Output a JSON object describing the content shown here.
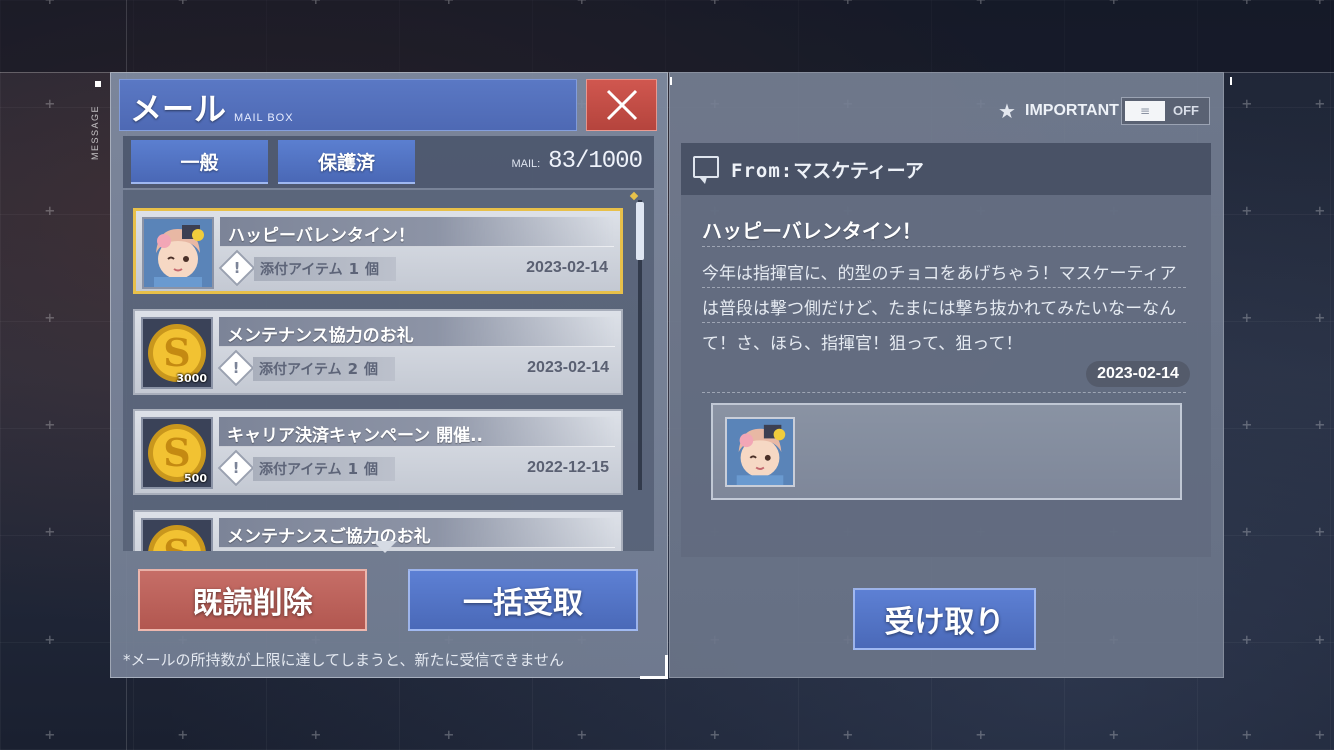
{
  "side_label": "MESSAGE",
  "header": {
    "title": "メール",
    "subtitle": "MAIL BOX"
  },
  "tabs": [
    {
      "label": "一般"
    },
    {
      "label": "保護済"
    }
  ],
  "mail_counter": {
    "label": "MAIL:",
    "value": "83/1000"
  },
  "mails": [
    {
      "title": "ハッピーバレンタイン！",
      "attach_label": "添付アイテム",
      "attach_count": "1",
      "attach_unit": "個",
      "date": "2023-02-14",
      "icon": "character-portrait-icon",
      "selected": true
    },
    {
      "title": "メンテナンス協力のお礼",
      "attach_label": "添付アイテム",
      "attach_count": "2",
      "attach_unit": "個",
      "date": "2023-02-14",
      "icon": "gold-coin-icon",
      "quantity": "3000"
    },
    {
      "title": "キャリア決済キャンペーン 開催..",
      "attach_label": "添付アイテム",
      "attach_count": "1",
      "attach_unit": "個",
      "date": "2022-12-15",
      "icon": "gold-coin-icon",
      "quantity": "500"
    },
    {
      "title": "メンテナンスご協力のお礼",
      "icon": "gold-coin-icon"
    }
  ],
  "buttons": {
    "delete_read": "既読削除",
    "receive_all": "一括受取",
    "receive": "受け取り"
  },
  "note": "*メールの所持数が上限に達してしまうと、新たに受信できません",
  "important": {
    "label": "IMPORTANT",
    "toggle_state": "OFF"
  },
  "detail": {
    "from_prefix": "From:",
    "from_name": "マスケティーア",
    "title": "ハッピーバレンタイン！",
    "body": "今年は指揮官に、的型のチョコをあげちゃう！マスケーティアは普段は撃つ側だけど、たまには撃ち抜かれてみたいなーなんて！さ、ほら、指揮官！狙って、狙って！",
    "date": "2023-02-14"
  },
  "colors": {
    "accent_blue": "#4e69b4",
    "accent_red": "#b5443d",
    "selected_border": "#e8c04a"
  }
}
